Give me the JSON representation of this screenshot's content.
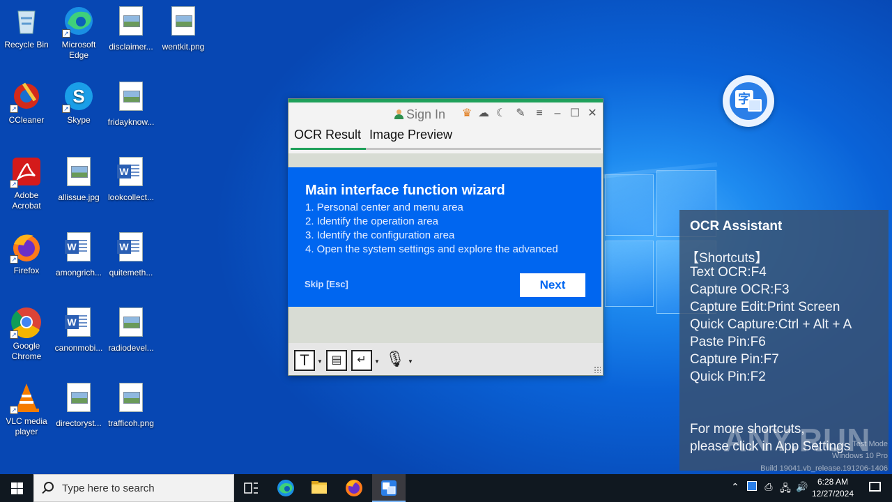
{
  "desktop_icons": [
    {
      "name": "recycle-bin",
      "label": "Recycle Bin",
      "kind": "recycle"
    },
    {
      "name": "microsoft-edge",
      "label": "Microsoft Edge",
      "kind": "edge"
    },
    {
      "name": "disclaimer",
      "label": "disclaimer...",
      "kind": "image"
    },
    {
      "name": "wentkit",
      "label": "wentkit.png",
      "kind": "image"
    },
    {
      "name": "ccleaner",
      "label": "CCleaner",
      "kind": "ccleaner"
    },
    {
      "name": "skype",
      "label": "Skype",
      "kind": "skype"
    },
    {
      "name": "fridayknow",
      "label": "fridayknow...",
      "kind": "image"
    },
    {
      "name": "adobe-acrobat",
      "label": "Adobe Acrobat",
      "kind": "acrobat"
    },
    {
      "name": "allissue",
      "label": "allissue.jpg",
      "kind": "image"
    },
    {
      "name": "lookcollect",
      "label": "lookcollect...",
      "kind": "doc"
    },
    {
      "name": "firefox",
      "label": "Firefox",
      "kind": "firefox"
    },
    {
      "name": "amongrich",
      "label": "amongrich...",
      "kind": "doc"
    },
    {
      "name": "quitemeth",
      "label": "quitemeth...",
      "kind": "doc"
    },
    {
      "name": "google-chrome",
      "label": "Google Chrome",
      "kind": "chrome"
    },
    {
      "name": "canonmobi",
      "label": "canonmobi...",
      "kind": "doc"
    },
    {
      "name": "radiodevel",
      "label": "radiodevel...",
      "kind": "image"
    },
    {
      "name": "vlc",
      "label": "VLC media player",
      "kind": "vlc"
    },
    {
      "name": "directoryst",
      "label": "directoryst...",
      "kind": "image"
    },
    {
      "name": "trafficoh",
      "label": "trafficoh.png",
      "kind": "image"
    }
  ],
  "ocr_window": {
    "sign_in": "Sign In",
    "tabs": [
      "OCR Result",
      "Image Preview"
    ],
    "titlebar_icons": [
      "crown-icon",
      "weather-icon",
      "moon-icon",
      "pin-icon",
      "menu-icon",
      "minimize-icon",
      "maximize-icon",
      "close-icon"
    ]
  },
  "wizard": {
    "title": "Main interface function wizard",
    "steps": [
      "1. Personal center and menu area",
      "2. Identify the operation area",
      "3. Identify the configuration area",
      "4. Open the system settings and explore the advanced"
    ],
    "skip": "Skip [Esc]",
    "next": "Next"
  },
  "assistant": {
    "title": "OCR Assistant",
    "lines": [
      "【Shortcuts】",
      "Text OCR:F4",
      "Capture OCR:F3",
      "Capture Edit:Print Screen",
      "Quick Capture:Ctrl + Alt + A",
      "Paste Pin:F6",
      "Capture Pin:F7",
      "Quick Pin:F2"
    ],
    "footer": [
      "For more shortcuts,",
      "please click in App Settings"
    ]
  },
  "watermark": {
    "brand": "ANY.RUN",
    "lines": [
      "Test Mode",
      "Windows 10 Pro",
      "Build 19041.vb_release.191206-1406"
    ]
  },
  "taskbar": {
    "search_placeholder": "Type here to search",
    "clock_time": "6:28 AM",
    "clock_date": "12/27/2024"
  }
}
